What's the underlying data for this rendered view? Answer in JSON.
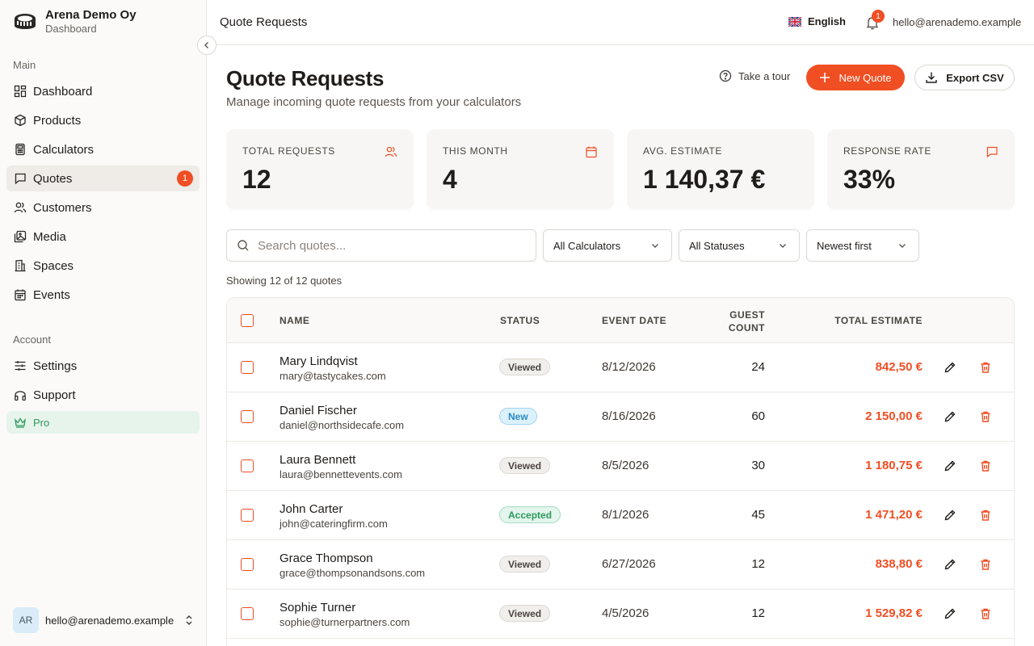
{
  "brand": {
    "name": "Arena Demo Oy",
    "subtitle": "Dashboard"
  },
  "sidebar": {
    "section_main": "Main",
    "section_account": "Account",
    "main_items": [
      {
        "label": "Dashboard",
        "icon": "grid-icon"
      },
      {
        "label": "Products",
        "icon": "box-icon"
      },
      {
        "label": "Calculators",
        "icon": "calculator-icon"
      },
      {
        "label": "Quotes",
        "icon": "message-icon",
        "badge": "1",
        "active": true
      },
      {
        "label": "Customers",
        "icon": "users-icon"
      },
      {
        "label": "Media",
        "icon": "image-icon"
      },
      {
        "label": "Spaces",
        "icon": "building-icon"
      },
      {
        "label": "Events",
        "icon": "calendar-icon"
      }
    ],
    "account_items": [
      {
        "label": "Settings",
        "icon": "sliders-icon"
      },
      {
        "label": "Support",
        "icon": "headphones-icon"
      },
      {
        "label": "Pro",
        "icon": "crown-icon"
      }
    ],
    "user": {
      "initials": "AR",
      "email": "hello@arenademo.example"
    }
  },
  "topbar": {
    "title": "Quote Requests",
    "language": "English",
    "notifications": "1",
    "email": "hello@arenademo.example"
  },
  "page": {
    "title": "Quote Requests",
    "subtitle": "Manage incoming quote requests from your calculators",
    "tour_label": "Take a tour",
    "new_quote_label": "New Quote",
    "export_label": "Export CSV"
  },
  "stats": [
    {
      "label": "TOTAL REQUESTS",
      "value": "12",
      "icon": "users-icon"
    },
    {
      "label": "THIS MONTH",
      "value": "4",
      "icon": "calendar-icon"
    },
    {
      "label": "AVG. ESTIMATE",
      "value": "1 140,37 €",
      "icon": ""
    },
    {
      "label": "RESPONSE RATE",
      "value": "33%",
      "icon": "message-icon"
    }
  ],
  "filters": {
    "search_placeholder": "Search quotes...",
    "calculator": "All Calculators",
    "status": "All Statuses",
    "sort": "Newest first",
    "showing": "Showing 12 of 12 quotes"
  },
  "table": {
    "headers": {
      "name": "NAME",
      "status": "STATUS",
      "event_date": "EVENT DATE",
      "guest_line1": "GUEST",
      "guest_line2": "COUNT",
      "total": "TOTAL ESTIMATE"
    },
    "rows": [
      {
        "name": "Mary Lindqvist",
        "email": "mary@tastycakes.com",
        "status": "Viewed",
        "date": "8/12/2026",
        "guests": "24",
        "total": "842,50 €"
      },
      {
        "name": "Daniel Fischer",
        "email": "daniel@northsidecafe.com",
        "status": "New",
        "date": "8/16/2026",
        "guests": "60",
        "total": "2 150,00 €"
      },
      {
        "name": "Laura Bennett",
        "email": "laura@bennettevents.com",
        "status": "Viewed",
        "date": "8/5/2026",
        "guests": "30",
        "total": "1 180,75 €"
      },
      {
        "name": "John Carter",
        "email": "john@cateringfirm.com",
        "status": "Accepted",
        "date": "8/1/2026",
        "guests": "45",
        "total": "1 471,20 €"
      },
      {
        "name": "Grace Thompson",
        "email": "grace@thompsonandsons.com",
        "status": "Viewed",
        "date": "6/27/2026",
        "guests": "12",
        "total": "838,80 €"
      },
      {
        "name": "Sophie Turner",
        "email": "sophie@turnerpartners.com",
        "status": "Viewed",
        "date": "4/5/2026",
        "guests": "12",
        "total": "1 529,82 €"
      }
    ]
  },
  "colors": {
    "accent": "#f04e23",
    "sidebar_bg": "#fbfaf9",
    "card_bg": "#f8f6f4"
  }
}
